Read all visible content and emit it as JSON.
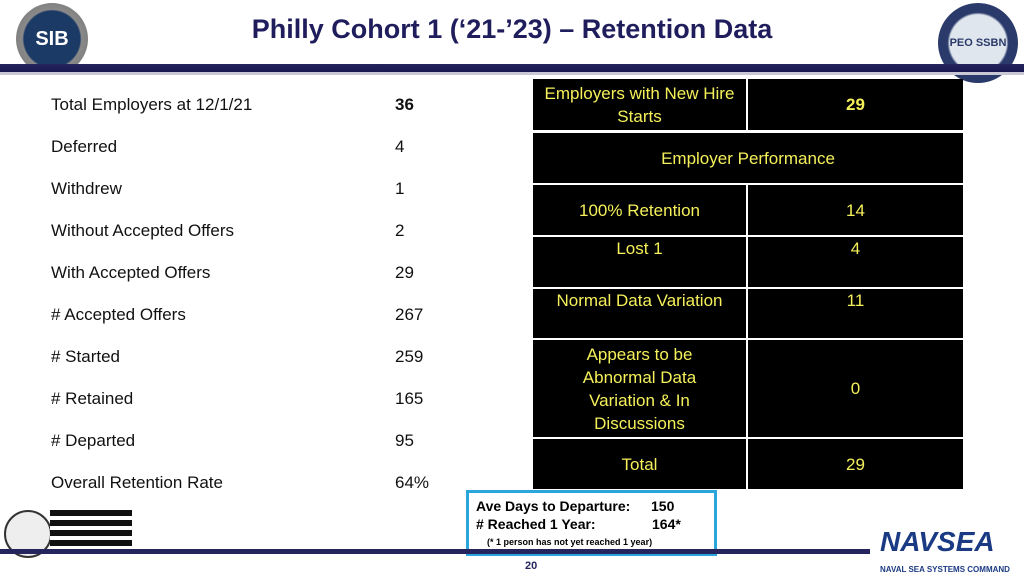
{
  "header": {
    "title": "Philly Cohort 1 (‘21-’23) – Retention Data",
    "left_logo_text": "SIB",
    "right_logo_text": "PEO SSBN"
  },
  "summary": [
    {
      "label": "Total Employers at 12/1/21",
      "value": "36",
      "bold": true
    },
    {
      "label": "Deferred",
      "value": "4"
    },
    {
      "label": "Withdrew",
      "value": "1"
    },
    {
      "label": "Without Accepted Offers",
      "value": "2"
    },
    {
      "label": "With Accepted Offers",
      "value": "29"
    },
    {
      "label": "# Accepted Offers",
      "value": "267"
    },
    {
      "label": "# Started",
      "value": "259"
    },
    {
      "label": "# Retained",
      "value": "165"
    },
    {
      "label": "# Departed",
      "value": "95"
    },
    {
      "label": "Overall Retention Rate",
      "value": "64%"
    }
  ],
  "performance": {
    "new_hire_label": "Employers with New Hire Starts",
    "new_hire_value": "29",
    "header": "Employer Performance",
    "rows": [
      {
        "label": "100% Retention",
        "value": "14"
      },
      {
        "label": "Lost 1",
        "value": "4"
      },
      {
        "label": "Normal Data Variation",
        "value": "11"
      },
      {
        "label": "Appears to be Abnormal Data Variation & In Discussions",
        "value": "0"
      },
      {
        "label": "Total",
        "value": "29"
      }
    ]
  },
  "callout": {
    "ave_label": "Ave Days to Departure:",
    "ave_value": "150",
    "reached_label": "# Reached 1 Year:",
    "reached_value": "164*",
    "note": "(* 1 person has not yet reached 1 year)"
  },
  "footer": {
    "page": "20",
    "navsea": "NAVSEA",
    "navsea_sub": "NAVAL SEA SYSTEMS COMMAND"
  },
  "colors": {
    "title": "#1f1d5c",
    "table_text": "#f5f05a",
    "callout_border": "#2aa6dc"
  }
}
